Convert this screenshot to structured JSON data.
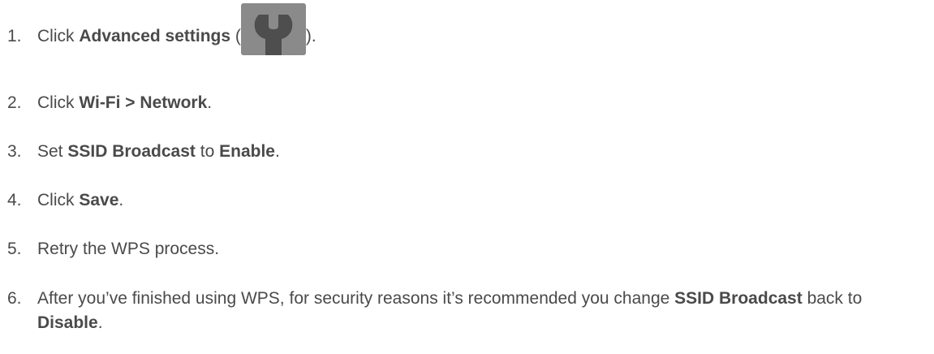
{
  "steps": [
    {
      "number": "1.",
      "parts": [
        {
          "text": "Click "
        },
        {
          "text": "Advanced settings",
          "bold": true
        },
        {
          "text": " ("
        },
        {
          "icon": "wrench-icon"
        },
        {
          "text": ")."
        }
      ]
    },
    {
      "number": "2.",
      "parts": [
        {
          "text": "Click "
        },
        {
          "text": "Wi-Fi > Network",
          "bold": true
        },
        {
          "text": "."
        }
      ]
    },
    {
      "number": "3.",
      "parts": [
        {
          "text": "Set "
        },
        {
          "text": "SSID Broadcast",
          "bold": true
        },
        {
          "text": " to "
        },
        {
          "text": "Enable",
          "bold": true
        },
        {
          "text": "."
        }
      ]
    },
    {
      "number": "4.",
      "parts": [
        {
          "text": "Click "
        },
        {
          "text": "Save",
          "bold": true
        },
        {
          "text": "."
        }
      ]
    },
    {
      "number": "5.",
      "parts": [
        {
          "text": "Retry the WPS process."
        }
      ]
    },
    {
      "number": "6.",
      "parts": [
        {
          "text": "After you’ve finished using WPS, for security reasons it’s recommended you change "
        },
        {
          "text": "SSID Broadcast",
          "bold": true
        },
        {
          "text": " back to "
        },
        {
          "text": "Disable",
          "bold": true
        },
        {
          "text": "."
        }
      ]
    }
  ],
  "colors": {
    "text": "#4a4a4a",
    "icon_background": "#8a8a8a",
    "icon_foreground": "#4e4e4e"
  }
}
